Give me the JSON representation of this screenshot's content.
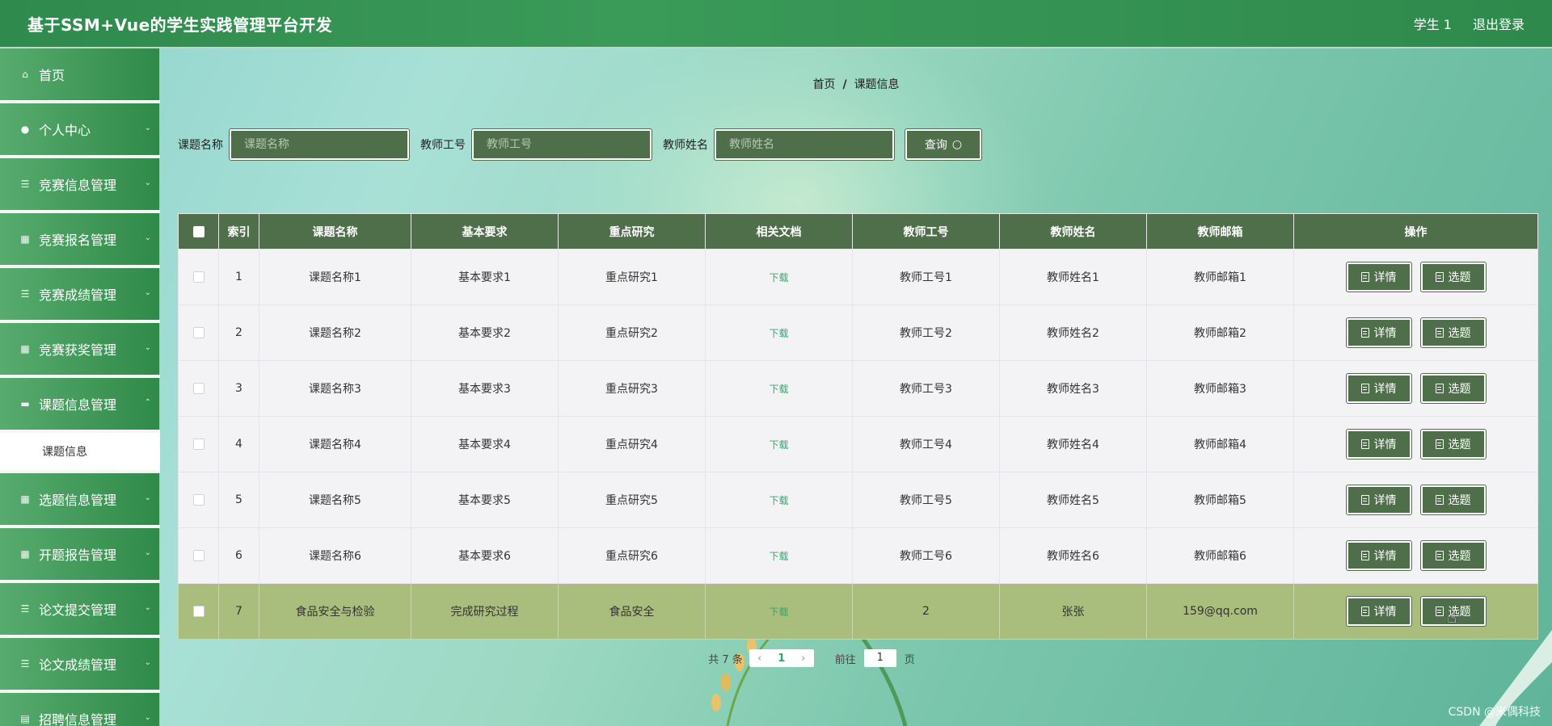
{
  "header": {
    "title": "基于SSM+Vue的学生实践管理平台开发",
    "user": "学生 1",
    "logout": "退出登录"
  },
  "sidebar": {
    "items": [
      {
        "label": "首页",
        "icon": "home-icon"
      },
      {
        "label": "个人中心",
        "icon": "user-icon"
      },
      {
        "label": "竞赛信息管理",
        "icon": "list-icon"
      },
      {
        "label": "竞赛报名管理",
        "icon": "grid-icon"
      },
      {
        "label": "竞赛成绩管理",
        "icon": "sliders-icon"
      },
      {
        "label": "竞赛获奖管理",
        "icon": "grid-icon"
      },
      {
        "label": "课题信息管理",
        "icon": "monitor-icon"
      },
      {
        "label": "选题信息管理",
        "icon": "grid-icon"
      },
      {
        "label": "开题报告管理",
        "icon": "grid-icon"
      },
      {
        "label": "论文提交管理",
        "icon": "list-icon"
      },
      {
        "label": "论文成绩管理",
        "icon": "list-icon"
      },
      {
        "label": "招聘信息管理",
        "icon": "clipboard-icon"
      }
    ],
    "sub_item": "课题信息"
  },
  "breadcrumb": {
    "home": "首页",
    "sep": "/",
    "current": "课题信息"
  },
  "search": {
    "f1_label": "课题名称",
    "f1_placeholder": "课题名称",
    "f2_label": "教师工号",
    "f2_placeholder": "教师工号",
    "f3_label": "教师姓名",
    "f3_placeholder": "教师姓名",
    "query_label": "查询"
  },
  "table": {
    "headers": [
      "索引",
      "课题名称",
      "基本要求",
      "重点研究",
      "相关文档",
      "教师工号",
      "教师姓名",
      "教师邮箱",
      "操作"
    ],
    "download_label": "下载",
    "detail_label": "详情",
    "select_label": "选题",
    "rows": [
      [
        "1",
        "课题名称1",
        "基本要求1",
        "重点研究1",
        "教师工号1",
        "教师姓名1",
        "教师邮箱1"
      ],
      [
        "2",
        "课题名称2",
        "基本要求2",
        "重点研究2",
        "教师工号2",
        "教师姓名2",
        "教师邮箱2"
      ],
      [
        "3",
        "课题名称3",
        "基本要求3",
        "重点研究3",
        "教师工号3",
        "教师姓名3",
        "教师邮箱3"
      ],
      [
        "4",
        "课题名称4",
        "基本要求4",
        "重点研究4",
        "教师工号4",
        "教师姓名4",
        "教师邮箱4"
      ],
      [
        "5",
        "课题名称5",
        "基本要求5",
        "重点研究5",
        "教师工号5",
        "教师姓名5",
        "教师邮箱5"
      ],
      [
        "6",
        "课题名称6",
        "基本要求6",
        "重点研究6",
        "教师工号6",
        "教师姓名6",
        "教师邮箱6"
      ],
      [
        "7",
        "食品安全与检验",
        "完成研究过程",
        "食品安全",
        "2",
        "张张",
        "159@qq.com"
      ]
    ]
  },
  "pager": {
    "total": "共 7 条",
    "current": "1",
    "goto_prefix": "前往",
    "goto_value": "1",
    "goto_suffix": "页"
  },
  "watermark": "CSDN @米偶科技",
  "colors": {
    "header": "#2f8a4d",
    "button": "#4f6e4a",
    "highlight_row": "#a9bd7c",
    "link": "#2fa86c"
  }
}
